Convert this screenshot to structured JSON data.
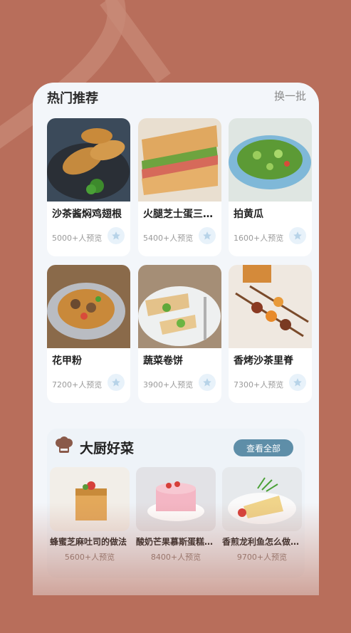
{
  "colors": {
    "background": "#b86e5b",
    "panel": "#f3f6fa",
    "accent": "#5e8ea8",
    "fav_bg": "#e8f2fa"
  },
  "hot": {
    "title": "热门推荐",
    "refresh": "换一批",
    "items": [
      {
        "name": "沙茶酱焖鸡翅根",
        "views": "5000+人预览",
        "icon": "star-icon"
      },
      {
        "name": "火腿芝士蛋三明治",
        "views": "5400+人预览",
        "icon": "star-icon"
      },
      {
        "name": "拍黄瓜",
        "views": "1600+人预览",
        "icon": "star-icon"
      },
      {
        "name": "花甲粉",
        "views": "7200+人预览",
        "icon": "star-icon"
      },
      {
        "name": "蔬菜卷饼",
        "views": "3900+人预览",
        "icon": "star-icon"
      },
      {
        "name": "香烤沙茶里脊",
        "views": "7300+人预览",
        "icon": "star-icon"
      }
    ]
  },
  "chef": {
    "title": "大厨好菜",
    "icon": "chef-hat-icon",
    "view_all": "查看全部",
    "items": [
      {
        "name": "蜂蜜芝麻吐司的做法",
        "views": "5600+人预览"
      },
      {
        "name": "酸奶芒果慕斯蛋糕的做法",
        "views": "8400+人预览"
      },
      {
        "name": "香煎龙利鱼怎么做好吃",
        "views": "9700+人预览"
      }
    ]
  }
}
